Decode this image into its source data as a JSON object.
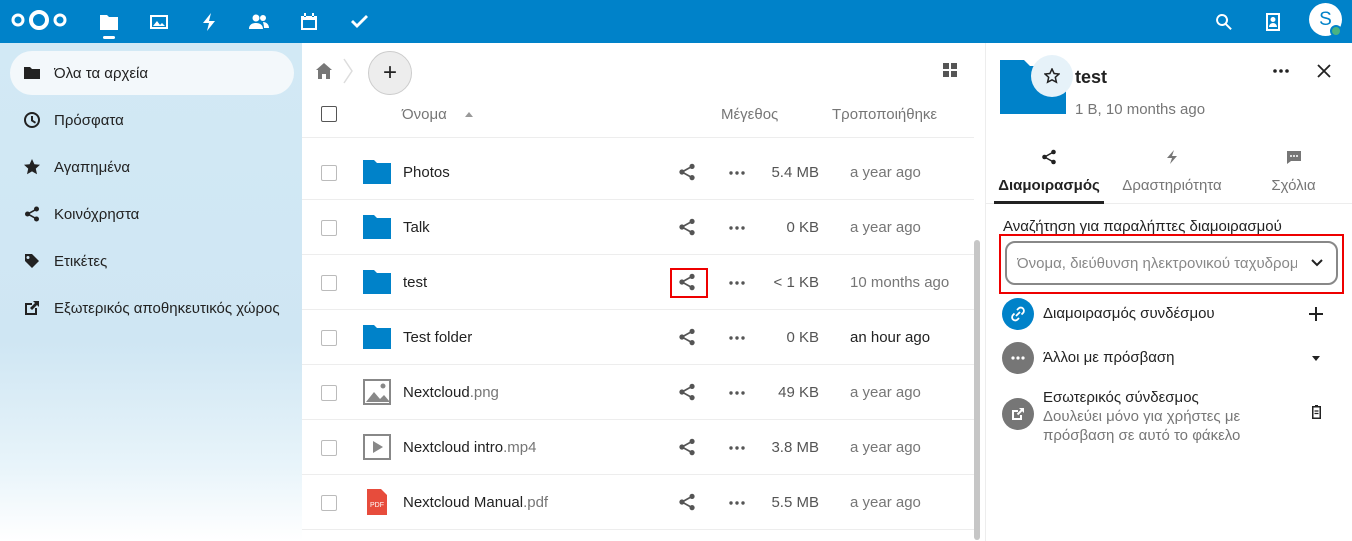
{
  "header": {
    "apps": [
      "files-icon",
      "photos-icon",
      "activity-icon",
      "contacts-icon",
      "calendar-icon",
      "tasks-icon"
    ],
    "right_icons": [
      "search-icon",
      "contacts-menu-icon"
    ],
    "avatar_letter": "S",
    "brand_color": "#0082c9"
  },
  "nav": {
    "items": [
      {
        "label": "Όλα τα αρχεία",
        "icon": "folder-icon"
      },
      {
        "label": "Πρόσφατα",
        "icon": "clock-icon"
      },
      {
        "label": "Αγαπημένα",
        "icon": "star-icon"
      },
      {
        "label": "Κοινόχρηστα",
        "icon": "share-icon"
      },
      {
        "label": "Ετικέτες",
        "icon": "tag-icon"
      },
      {
        "label": "Εξωτερικός αποθηκευτικός χώρος",
        "icon": "external-icon"
      }
    ]
  },
  "files": {
    "columns": {
      "name": "Όνομα",
      "size": "Μέγεθος",
      "modified": "Τροποποιήθηκε"
    },
    "rows": [
      {
        "name": "Photos",
        "ext": "",
        "type": "folder",
        "size": "5.4 MB",
        "modified": "a year ago"
      },
      {
        "name": "Talk",
        "ext": "",
        "type": "folder",
        "size": "0 KB",
        "modified": "a year ago"
      },
      {
        "name": "test",
        "ext": "",
        "type": "folder",
        "size": "< 1 KB",
        "modified": "10 months ago"
      },
      {
        "name": "Test folder",
        "ext": "",
        "type": "folder",
        "size": "0 KB",
        "modified": "an hour ago"
      },
      {
        "name": "Nextcloud",
        "ext": ".png",
        "type": "image",
        "size": "49 KB",
        "modified": "a year ago"
      },
      {
        "name": "Nextcloud intro",
        "ext": ".mp4",
        "type": "video",
        "size": "3.8 MB",
        "modified": "a year ago"
      },
      {
        "name": "Nextcloud Manual",
        "ext": ".pdf",
        "type": "pdf",
        "size": "5.5 MB",
        "modified": "a year ago"
      }
    ]
  },
  "sidebar": {
    "title": "test",
    "subtitle": "1 B, 10 months ago",
    "tabs": {
      "sharing": "Διαμοιρασμός",
      "activity": "Δραστηριότητα",
      "comments": "Σχόλια"
    },
    "search_label": "Αναζήτηση για παραλήπτες διαμοιρασμού",
    "search_placeholder": "Όνομα, διεύθυνση ηλεκτρονικού ταχυδρομείου",
    "link_share": "Διαμοιρασμός συνδέσμου",
    "others_access": "Άλλοι με πρόσβαση",
    "internal_link_title": "Εσωτερικός σύνδεσμος",
    "internal_link_desc": "Δουλεύει μόνο για χρήστες με πρόσβαση σε αυτό το φάκελο"
  }
}
